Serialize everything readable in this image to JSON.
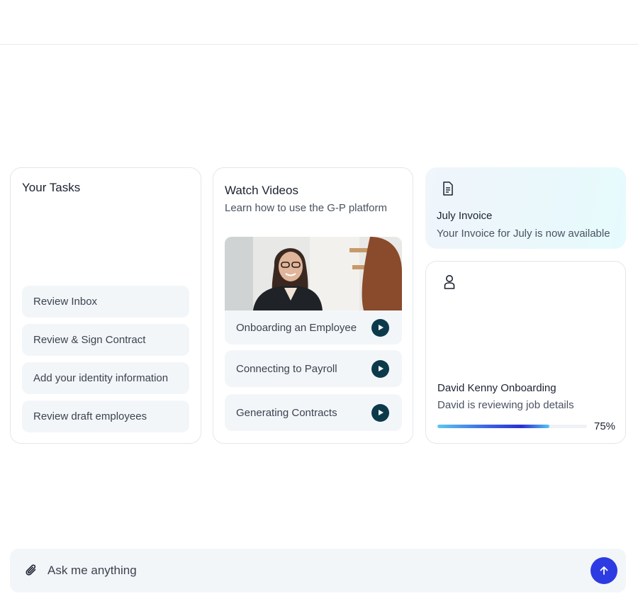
{
  "tasks": {
    "title": "Your Tasks",
    "items": [
      {
        "label": "Review Inbox"
      },
      {
        "label": "Review & Sign Contract"
      },
      {
        "label": "Add your identity information"
      },
      {
        "label": "Review draft employees"
      }
    ]
  },
  "videos": {
    "title": "Watch Videos",
    "subtitle": "Learn how to use the G-P platform",
    "items": [
      {
        "label": "Onboarding an Employee",
        "icon": "play-icon"
      },
      {
        "label": "Connecting to Payroll",
        "icon": "play-icon"
      },
      {
        "label": "Generating Contracts",
        "icon": "play-icon"
      }
    ]
  },
  "invoice": {
    "icon": "document-icon",
    "title": "July Invoice",
    "subtitle": "Your Invoice for July is now available"
  },
  "onboarding": {
    "icon": "person-icon",
    "title": "David Kenny Onboarding",
    "subtitle": "David is reviewing job details",
    "progress": 0.75,
    "progress_label": "75%"
  },
  "chat": {
    "placeholder": "Ask me anything",
    "attach_icon": "paperclip-icon",
    "send_icon": "arrow-up-icon"
  },
  "colors": {
    "accent": "#2d3be3",
    "play_button": "#0d3a4b",
    "chip_bg": "#f3f6f9"
  }
}
